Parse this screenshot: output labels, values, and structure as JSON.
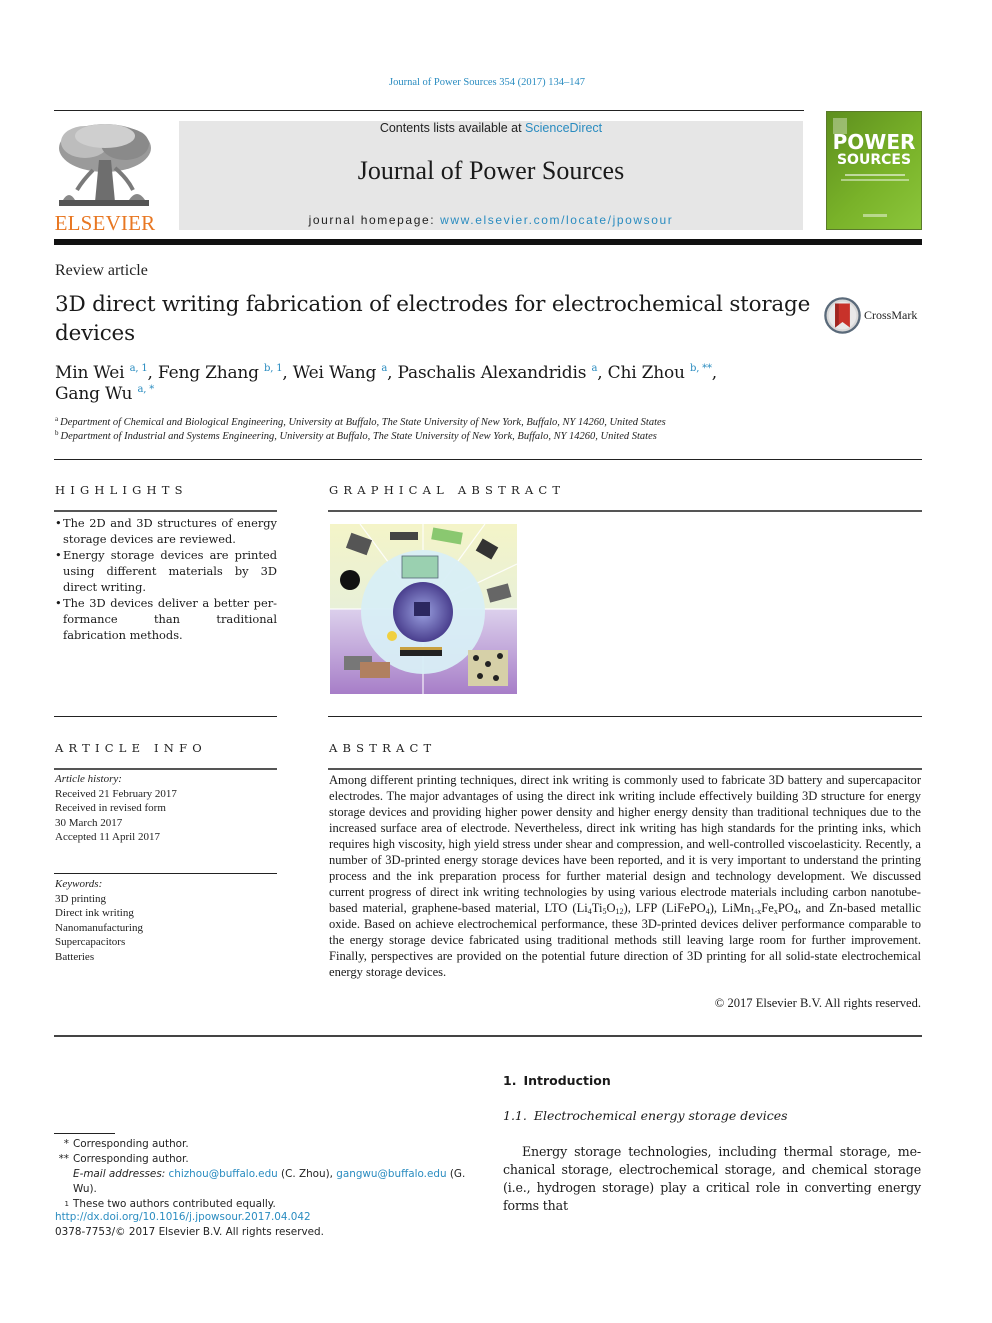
{
  "citation": "Journal of Power Sources 354 (2017) 134–147",
  "header": {
    "publisher_logo_text": "ELSEVIER",
    "contents_prefix": "Contents lists available at ",
    "contents_link": "ScienceDirect",
    "journal_title": "Journal of Power Sources",
    "homepage_prefix": "journal homepage: ",
    "homepage_link": "www.elsevier.com/locate/jpowsour",
    "cover": {
      "line1": "POWER",
      "line2": "SOURCES"
    }
  },
  "article": {
    "type": "Review article",
    "title": "3D direct writing fabrication of electrodes for electrochemical storage devices",
    "crossmark_label": "CrossMark",
    "authors": [
      {
        "name": "Min Wei",
        "sup": "a, 1",
        "sep": ", "
      },
      {
        "name": "Feng Zhang",
        "sup": "b, 1",
        "sep": ", "
      },
      {
        "name": "Wei Wang",
        "sup": "a",
        "sep": ", "
      },
      {
        "name": "Paschalis Alexandridis",
        "sup": "a",
        "sep": ", "
      },
      {
        "name": "Chi Zhou",
        "sup": "b, **",
        "sep": ","
      },
      {
        "name": "Gang Wu",
        "sup": "a, *",
        "sep": ""
      }
    ],
    "affiliations": [
      {
        "mark": "a",
        "text": "Department of Chemical and Biological Engineering, University at Buffalo, The State University of New York, Buffalo, NY 14260, United States"
      },
      {
        "mark": "b",
        "text": "Department of Industrial and Systems Engineering, University at Buffalo, The State University of New York, Buffalo, NY 14260, United States"
      }
    ]
  },
  "highlights": {
    "heading": "HIGHLIGHTS",
    "items": [
      "The 2D and 3D structures of energy storage devices are reviewed.",
      "Energy storage devices are printed using different materials by 3D direct writing.",
      "The 3D devices deliver a better per-formance than traditional fabrication methods."
    ]
  },
  "graphical_abstract": {
    "heading": "GRAPHICAL ABSTRACT",
    "image_alt": "Graphical abstract: circular diagram of 3D direct-written energy storage devices"
  },
  "article_info": {
    "heading": "ARTICLE INFO",
    "history_label": "Article history:",
    "history": [
      "Received 21 February 2017",
      "Received in revised form",
      "30 March 2017",
      "Accepted 11 April 2017"
    ],
    "keywords_label": "Keywords:",
    "keywords": [
      "3D printing",
      "Direct ink writing",
      "Nanomanufacturing",
      "Supercapacitors",
      "Batteries"
    ]
  },
  "abstract": {
    "heading": "ABSTRACT",
    "part1": "Among different printing techniques, direct ink writing is commonly used to fabricate 3D battery and supercapacitor electrodes. The major advantages of using the direct ink writing include effectively building 3D structure for energy storage devices and providing higher power density and higher energy density than traditional techniques due to the increased surface area of electrode. Nevertheless, direct ink writing has high standards for the printing inks, which requires high viscosity, high yield stress under shear and compression, and well-controlled viscoelasticity. Recently, a number of 3D-printed energy storage devices have been reported, and it is very important to understand the printing process and the ink preparation process for further material design and technology development. We discussed current progress of direct ink writing technologies by using various electrode materials including carbon nanotube-based material, graphene-based material, LTO (Li",
    "lto_sub1": "4",
    "lto_mid1": "Ti",
    "lto_sub2": "5",
    "lto_mid2": "O",
    "lto_sub3": "12",
    "part2": "), LFP (LiFePO",
    "lfp_sub": "4",
    "part3": "), LiMn",
    "lmfp_sub1": "1-x",
    "lmfp_mid1": "Fe",
    "lmfp_sub2": "x",
    "lmfp_mid2": "PO",
    "lmfp_sub3": "4",
    "part4": ", and Zn-based metallic oxide. Based on achieve electrochemical performance, these 3D-printed devices deliver performance comparable to the energy storage device fabricated using traditional methods still leaving large room for further improvement. Finally, perspectives are provided on the potential future direction of 3D printing for all solid-state electrochemical energy storage devices.",
    "copyright": "© 2017 Elsevier B.V. All rights reserved."
  },
  "footnotes": {
    "corresponding1_mark": "*",
    "corresponding1": "Corresponding author.",
    "corresponding2_mark": "**",
    "corresponding2": "Corresponding author.",
    "email_label": "E-mail addresses: ",
    "email1": "chizhou@buffalo.edu",
    "email1_owner": " (C. Zhou), ",
    "email2": "gangwu@buffalo.edu",
    "email2_owner": " (G. Wu).",
    "equal_mark": "1",
    "equal": "These two authors contributed equally.",
    "doi": "http://dx.doi.org/10.1016/j.jpowsour.2017.04.042",
    "issn": "0378-7753/© 2017 Elsevier B.V. All rights reserved."
  },
  "introduction": {
    "section_num": "1.",
    "section_title": "Introduction",
    "subsection_num": "1.1.",
    "subsection_title": "Electrochemical energy storage devices",
    "text": "Energy storage technologies, including thermal storage, me-chanical storage, electrochemical storage, and chemical storage (i.e., hydrogen storage) play a critical role in converting energy forms that"
  },
  "colors": {
    "link": "#2a8cc0",
    "elsevier_orange": "#e87722",
    "cover_green": "#79b229",
    "header_band": "#e6e6e6"
  }
}
